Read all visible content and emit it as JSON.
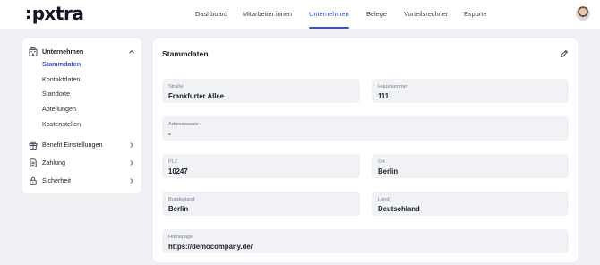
{
  "brand": {
    "logo_text": "pxtra",
    "logo_prefix": ":"
  },
  "nav": {
    "items": [
      {
        "label": "Dashboard"
      },
      {
        "label": "Mitarbeiter:innen"
      },
      {
        "label": "Unternehmen"
      },
      {
        "label": "Belege"
      },
      {
        "label": "Vorteilsrechner"
      },
      {
        "label": "Exporte"
      }
    ],
    "active_index": 2
  },
  "sidebar": {
    "sections": [
      {
        "label": "Unternehmen",
        "icon": "building-icon",
        "expanded": true,
        "children": [
          {
            "label": "Stammdaten",
            "active": true
          },
          {
            "label": "Kontaktdaten"
          },
          {
            "label": "Standorte"
          },
          {
            "label": "Abteilungen"
          },
          {
            "label": "Kostenstellen"
          }
        ]
      },
      {
        "label": "Benefit Einstellungen",
        "icon": "gift-icon"
      },
      {
        "label": "Zahlung",
        "icon": "receipt-icon"
      },
      {
        "label": "Sicherheit",
        "icon": "lock-icon"
      }
    ]
  },
  "card": {
    "title": "Stammdaten",
    "fields": {
      "strasse": {
        "label": "Straße",
        "value": "Frankfurter Allee"
      },
      "hausnummer": {
        "label": "Hausnummer",
        "value": "111"
      },
      "adresszusatz": {
        "label": "Adresszusatz",
        "value": "-"
      },
      "plz": {
        "label": "PLZ",
        "value": "10247"
      },
      "ort": {
        "label": "Ort",
        "value": "Berlin"
      },
      "bundesland": {
        "label": "Bundesland",
        "value": "Berlin"
      },
      "land": {
        "label": "Land",
        "value": "Deutschland"
      },
      "homepage": {
        "label": "Homepage",
        "value": "https://democompany.de/"
      }
    }
  },
  "colors": {
    "accent": "#3a4fd9",
    "background": "#eef0f4",
    "field": "#f1f2f5"
  }
}
